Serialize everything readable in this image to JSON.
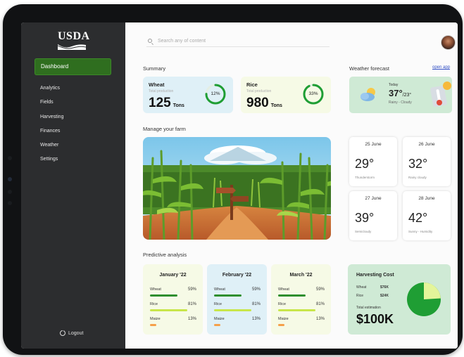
{
  "sidebar": {
    "logo": "USDA",
    "active_item": "Dashboard",
    "items": [
      "Analytics",
      "Fields",
      "Harvesting",
      "Finances",
      "Weather",
      "Settings"
    ],
    "logout": "Logout"
  },
  "search": {
    "placeholder": "Search any of content"
  },
  "summary": {
    "title": "Summary",
    "crops": [
      {
        "name": "Wheat",
        "sub": "Total production",
        "value": "125",
        "unit": "Tons",
        "percent": "12%",
        "fraction": 0.12,
        "bg": "#dff0f7"
      },
      {
        "name": "Rice",
        "sub": "Total production",
        "value": "980",
        "unit": "Tons",
        "percent": "33%",
        "fraction": 0.33,
        "bg": "#f6fae6"
      }
    ]
  },
  "weather": {
    "title": "Weather forecast",
    "open_app": "open app",
    "today_label": "Today",
    "temp": "37°",
    "temp_low": "/23°",
    "condition": "Rainy - Cloudy"
  },
  "manage": {
    "title": "Manage your farm"
  },
  "forecast": [
    {
      "date": "25 June",
      "temp": "29°",
      "desc": "Thunderstorm"
    },
    {
      "date": "26 June",
      "temp": "32°",
      "desc": "Rainy cloudy"
    },
    {
      "date": "27 June",
      "temp": "39°",
      "desc": "Semicloudy"
    },
    {
      "date": "28 June",
      "temp": "42°",
      "desc": "Sunny - Humidity"
    }
  ],
  "predictive": {
    "title": "Predictive analysis",
    "months": [
      {
        "month": "January '22",
        "bg": "#f6fae6",
        "rows": [
          {
            "name": "Wheat",
            "pct": "59%",
            "value": 0.59
          },
          {
            "name": "Rice",
            "pct": "81%",
            "value": 0.81
          },
          {
            "name": "Maize",
            "pct": "13%",
            "value": 0.13
          }
        ]
      },
      {
        "month": "February '22",
        "bg": "#dff0f7",
        "rows": [
          {
            "name": "Wheat",
            "pct": "59%",
            "value": 0.59
          },
          {
            "name": "Rice",
            "pct": "81%",
            "value": 0.81
          },
          {
            "name": "Maize",
            "pct": "13%",
            "value": 0.13
          }
        ]
      },
      {
        "month": "March '22",
        "bg": "#f6fae6",
        "rows": [
          {
            "name": "Wheat",
            "pct": "59%",
            "value": 0.59
          },
          {
            "name": "Rice",
            "pct": "81%",
            "value": 0.81
          },
          {
            "name": "Maize",
            "pct": "13%",
            "value": 0.13
          }
        ]
      }
    ],
    "colors": {
      "Wheat": "#2f8f2f",
      "Rice": "#c8e64a",
      "Maize": "#f5a04a"
    }
  },
  "harvesting_cost": {
    "title": "Harvesting Cost",
    "rows": [
      {
        "name": "Wheat",
        "value": "$76K"
      },
      {
        "name": "Rice",
        "value": "$24K"
      }
    ],
    "estimation_label": "Total estimation",
    "total": "$100K",
    "pie_fraction_wheat": 0.76,
    "colors": {
      "wheat": "#1f9e34",
      "rice": "#e4f59a"
    }
  }
}
